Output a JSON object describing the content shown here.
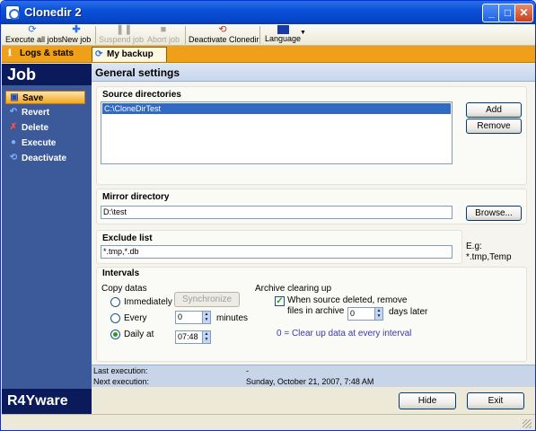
{
  "window": {
    "title": "Clonedir 2"
  },
  "toolbar": {
    "execute_all": "Execute all jobs",
    "new_job": "New job",
    "suspend_job": "Suspend job",
    "abort_job": "Abort job",
    "deactivate": "Deactivate Clonedir",
    "language": "Language"
  },
  "tabs": {
    "logs": "Logs & stats",
    "job": "My backup job"
  },
  "sidebar": {
    "title": "Job",
    "items": [
      "Save",
      "Revert",
      "Delete",
      "Execute",
      "Deactivate"
    ],
    "brand": "R4Yware"
  },
  "main": {
    "header": "General settings",
    "source": {
      "label": "Source directories",
      "items": [
        "C:\\CloneDirTest"
      ],
      "add": "Add",
      "remove": "Remove"
    },
    "mirror": {
      "label": "Mirror directory",
      "value": "D:\\test",
      "browse": "Browse..."
    },
    "exclude": {
      "label": "Exclude list",
      "value": "*.tmp,*.db",
      "example_label": "E.g:",
      "example_value": "*.tmp,Temp"
    },
    "intervals": {
      "label": "Intervals",
      "copy_datas": "Copy datas",
      "immediately": "Immediately",
      "synchronize": "Synchronize",
      "every": "Every",
      "every_value": "0",
      "minutes": "minutes",
      "daily_at": "Daily at",
      "daily_value": "07:48",
      "archive_label": "Archive clearing up",
      "archive_check_line1": "When source deleted, remove",
      "archive_check_line2": "files in archive",
      "archive_value": "0",
      "days_later": "days later",
      "note": "0 = Clear up data at every interval"
    }
  },
  "info": {
    "last_label": "Last execution:",
    "last_value": "-",
    "next_label": "Next execution:",
    "next_value": "Sunday, October 21, 2007, 7:48 AM"
  },
  "buttons": {
    "hide": "Hide",
    "exit": "Exit"
  },
  "colors": {
    "accent": "#f0a018",
    "sidebar": "#3c5a9a",
    "brand_bg": "#0a1a5a",
    "note": "#3a3aa8"
  }
}
